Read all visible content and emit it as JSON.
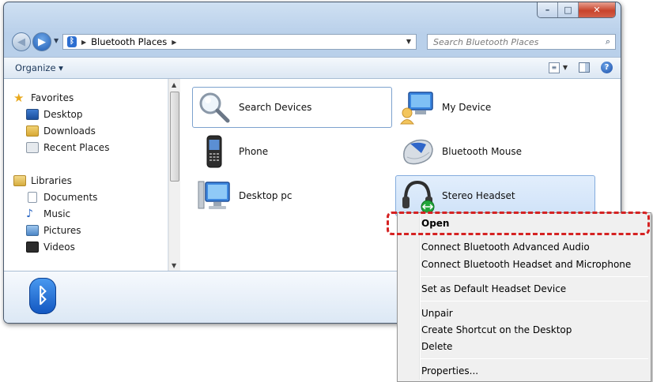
{
  "window": {
    "caption_buttons": {
      "minimize": "–",
      "maximize": "□",
      "close": "✕"
    }
  },
  "navigation": {
    "back_glyph": "◀",
    "forward_glyph": "▶",
    "dropdown_glyph": "▼",
    "breadcrumb_separator": "▶",
    "location": "Bluetooth Places",
    "refresh_glyph": "⇆",
    "search_placeholder": "Search Bluetooth Places"
  },
  "toolbar": {
    "organize_label": "Organize ▾",
    "views_dropdown": "▼",
    "help_glyph": "?"
  },
  "sidebar": {
    "favorites_header": "Favorites",
    "favorites": [
      "Desktop",
      "Downloads",
      "Recent Places"
    ],
    "libraries_header": "Libraries",
    "libraries": [
      "Documents",
      "Music",
      "Pictures",
      "Videos"
    ],
    "scroll_up": "▲",
    "scroll_down": "▼"
  },
  "devices": [
    {
      "label": "Search Devices",
      "icon": "magnifier-icon"
    },
    {
      "label": "My Device",
      "icon": "user-device-icon"
    },
    {
      "label": "Phone",
      "icon": "phone-icon"
    },
    {
      "label": "Bluetooth Mouse",
      "icon": "mouse-icon"
    },
    {
      "label": "Desktop pc",
      "icon": "computer-icon"
    },
    {
      "label": "Stereo Headset",
      "icon": "headset-icon"
    }
  ],
  "details_pane": {
    "bluetooth_glyph": "ᛒ"
  },
  "context_menu": {
    "open": "Open",
    "connect_advanced_audio": "Connect Bluetooth Advanced Audio",
    "connect_headset_mic": "Connect Bluetooth Headset and Microphone",
    "set_default": "Set as Default Headset Device",
    "unpair": "Unpair",
    "create_shortcut": "Create Shortcut on the Desktop",
    "delete": "Delete",
    "properties": "Properties..."
  },
  "colors": {
    "selection_fill": "#d6e6f9",
    "selection_border": "#84acdd",
    "highlight_annotation": "#d52222",
    "bluetooth_blue": "#1a64d0"
  }
}
